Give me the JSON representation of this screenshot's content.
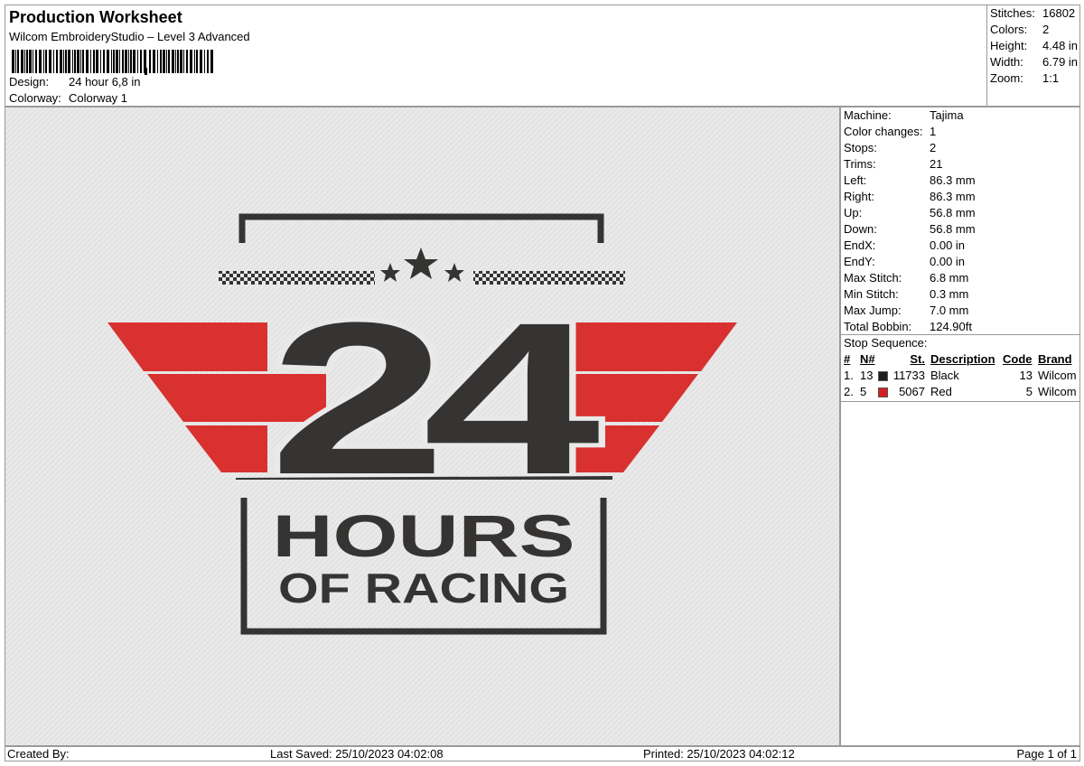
{
  "header": {
    "title": "Production Worksheet",
    "subtitle": "Wilcom EmbroideryStudio – Level 3 Advanced",
    "design_label": "Design:",
    "design_value": "24 hour 6,8 in",
    "colorway_label": "Colorway:",
    "colorway_value": "Colorway 1"
  },
  "summary": [
    {
      "label": "Stitches:",
      "value": "16802"
    },
    {
      "label": "Colors:",
      "value": "2"
    },
    {
      "label": "Height:",
      "value": "4.48 in"
    },
    {
      "label": "Width:",
      "value": "6.79 in"
    },
    {
      "label": "Zoom:",
      "value": "1:1"
    }
  ],
  "stats": [
    {
      "label": "Machine:",
      "value": "Tajima"
    },
    {
      "label": "Color changes:",
      "value": "1"
    },
    {
      "label": "Stops:",
      "value": "2"
    },
    {
      "label": "Trims:",
      "value": "21"
    },
    {
      "label": "Left:",
      "value": "86.3 mm"
    },
    {
      "label": "Right:",
      "value": "86.3 mm"
    },
    {
      "label": "Up:",
      "value": "56.8 mm"
    },
    {
      "label": "Down:",
      "value": "56.8 mm"
    },
    {
      "label": "EndX:",
      "value": "0.00 in"
    },
    {
      "label": "EndY:",
      "value": "0.00 in"
    },
    {
      "label": "Max Stitch:",
      "value": "6.8 mm"
    },
    {
      "label": "Min Stitch:",
      "value": "0.3 mm"
    },
    {
      "label": "Max Jump:",
      "value": "7.0 mm"
    },
    {
      "label": "Total Bobbin:",
      "value": "124.90ft"
    }
  ],
  "stop_sequence": {
    "title": "Stop Sequence:",
    "columns": {
      "index": "#",
      "needle": "N#",
      "stitches": "St.",
      "description": "Description",
      "code": "Code",
      "brand": "Brand"
    },
    "rows": [
      {
        "index": "1.",
        "needle": "13",
        "color": "#1e1e1e",
        "stitches": "11733",
        "description": "Black",
        "code": "13",
        "brand": "Wilcom"
      },
      {
        "index": "2.",
        "needle": "5",
        "color": "#d42020",
        "stitches": "5067",
        "description": "Red",
        "code": "5",
        "brand": "Wilcom"
      }
    ]
  },
  "design_art": {
    "big_number": "24",
    "line1": "HOURS",
    "line2": "OF RACING",
    "dark_color": "#363433",
    "red_color": "#d8312f",
    "background_color": "#e9e9e9"
  },
  "footer": {
    "created": "Created By:",
    "last_saved": "Last Saved: 25/10/2023 04:02:08",
    "printed": "Printed: 25/10/2023 04:02:12",
    "page": "Page 1 of 1"
  }
}
